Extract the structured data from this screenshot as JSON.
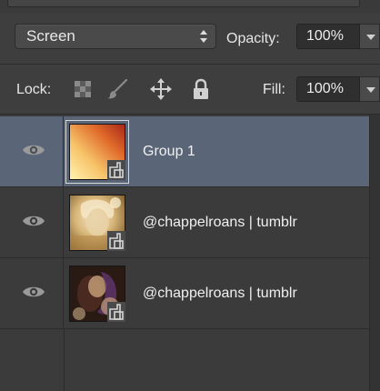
{
  "blend_mode": {
    "selected": "Screen"
  },
  "opacity": {
    "label": "Opacity:",
    "value": "100%"
  },
  "lock": {
    "label": "Lock:",
    "icons": [
      "transparency-lock-icon",
      "brush-lock-icon",
      "move-lock-icon",
      "padlock-icon"
    ]
  },
  "fill": {
    "label": "Fill:",
    "value": "100%"
  },
  "layers": [
    {
      "name": "Group 1",
      "selected": true,
      "thumbnail": "orange-gradient"
    },
    {
      "name": "@chappelroans | tumblr",
      "selected": false,
      "thumbnail": "photo-light"
    },
    {
      "name": "@chappelroans | tumblr",
      "selected": false,
      "thumbnail": "photo-dark"
    }
  ],
  "colors": {
    "panel_bg": "#3c3c3c",
    "selected_row": "#5a6577",
    "text": "#f0f0f0"
  }
}
